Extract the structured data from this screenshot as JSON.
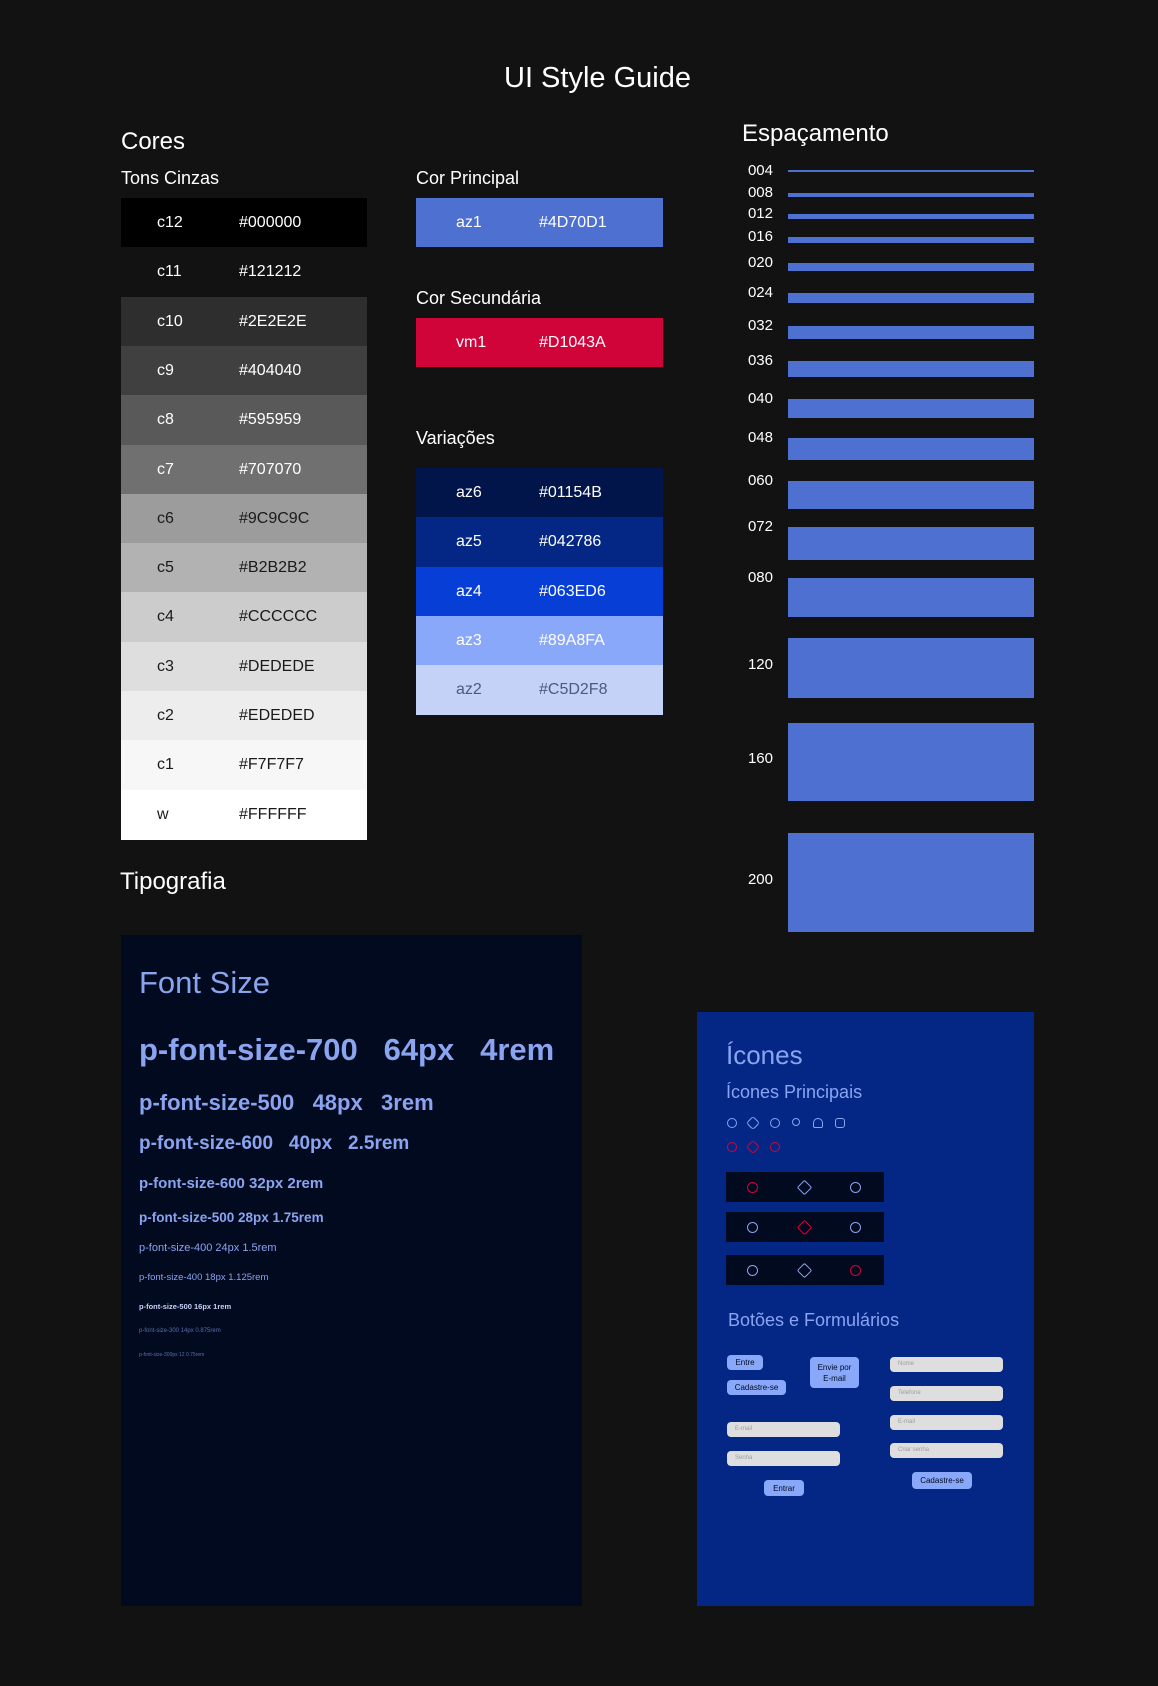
{
  "page_title": "UI Style Guide",
  "cores": {
    "heading": "Cores",
    "tons_cinzas": "Tons Cinzas",
    "grays": [
      {
        "name": "c12",
        "hex": "#000000",
        "bg": "#000000",
        "fg": "#ffffff"
      },
      {
        "name": "c11",
        "hex": "#121212",
        "bg": "#121212",
        "fg": "#ffffff"
      },
      {
        "name": "c10",
        "hex": "#2E2E2E",
        "bg": "#2E2E2E",
        "fg": "#ffffff"
      },
      {
        "name": "c9",
        "hex": "#404040",
        "bg": "#404040",
        "fg": "#ffffff"
      },
      {
        "name": "c8",
        "hex": "#595959",
        "bg": "#595959",
        "fg": "#ffffff"
      },
      {
        "name": "c7",
        "hex": "#707070",
        "bg": "#707070",
        "fg": "#ffffff"
      },
      {
        "name": "c6",
        "hex": "#9C9C9C",
        "bg": "#9C9C9C",
        "fg": "#1a1a1a"
      },
      {
        "name": "c5",
        "hex": "#B2B2B2",
        "bg": "#B2B2B2",
        "fg": "#1a1a1a"
      },
      {
        "name": "c4",
        "hex": "#CCCCCC",
        "bg": "#CCCCCC",
        "fg": "#1a1a1a"
      },
      {
        "name": "c3",
        "hex": "#DEDEDE",
        "bg": "#DEDEDE",
        "fg": "#1a1a1a"
      },
      {
        "name": "c2",
        "hex": "#EDEDED",
        "bg": "#EDEDED",
        "fg": "#1a1a1a"
      },
      {
        "name": "c1",
        "hex": "#F7F7F7",
        "bg": "#F7F7F7",
        "fg": "#1a1a1a"
      },
      {
        "name": "w",
        "hex": "#FFFFFF",
        "bg": "#FFFFFF",
        "fg": "#1a1a1a"
      }
    ],
    "cor_principal": "Cor Principal",
    "principal": {
      "name": "az1",
      "hex": "#4D70D1",
      "bg": "#4D70D1",
      "fg": "#ffffff"
    },
    "cor_secundaria": "Cor Secundária",
    "secundaria": {
      "name": "vm1",
      "hex": "#D1043A",
      "bg": "#D1043A",
      "fg": "#ffffff"
    },
    "variacoes": "Variações",
    "variations": [
      {
        "name": "az6",
        "hex": "#01154B",
        "bg": "#01154B",
        "fg": "#ffffff"
      },
      {
        "name": "az5",
        "hex": "#042786",
        "bg": "#042786",
        "fg": "#ffffff"
      },
      {
        "name": "az4",
        "hex": "#063ED6",
        "bg": "#063ED6",
        "fg": "#ffffff"
      },
      {
        "name": "az3",
        "hex": "#89A8FA",
        "bg": "#89A8FA",
        "fg": "#ffffff"
      },
      {
        "name": "az2",
        "hex": "#C5D2F8",
        "bg": "#C5D2F8",
        "fg": "#4a5a80"
      }
    ]
  },
  "espacamento": {
    "heading": "Espaçamento",
    "items": [
      "004",
      "008",
      "012",
      "016",
      "020",
      "024",
      "032",
      "036",
      "040",
      "048",
      "060",
      "072",
      "080",
      "120",
      "160",
      "200"
    ]
  },
  "tipografia": {
    "heading": "Tipografia",
    "panel_title": "Font Size",
    "lines": [
      "p-font-size-700   64px   4rem",
      "p-font-size-500   48px   3rem",
      "p-font-size-600   40px   2.5rem",
      "p-font-size-600 32px 2rem",
      "p-font-size-500 28px 1.75rem",
      "p-font-size-400 24px 1.5rem",
      "p-font-size-400 18px 1.125rem",
      "p-font-size-500 16px 1rem",
      "p-font-size-300 14px 0.875rem",
      "p-font-size-300px 12 0.75rem"
    ]
  },
  "icones": {
    "heading": "Ícones",
    "principais": "Ícones Principais",
    "botoes_formularios": "Botões e Formulários",
    "buttons": {
      "entre": "Entre",
      "cadastre": "Cadastre-se",
      "envie_email": "Envie por E-mail",
      "entrar": "Entrar",
      "cadastre2": "Cadastre-se"
    },
    "inputs_left": [
      "E-mail",
      "Senha"
    ],
    "inputs_right": [
      "Nome",
      "Telefone",
      "E-mail",
      "Criar senha"
    ]
  }
}
